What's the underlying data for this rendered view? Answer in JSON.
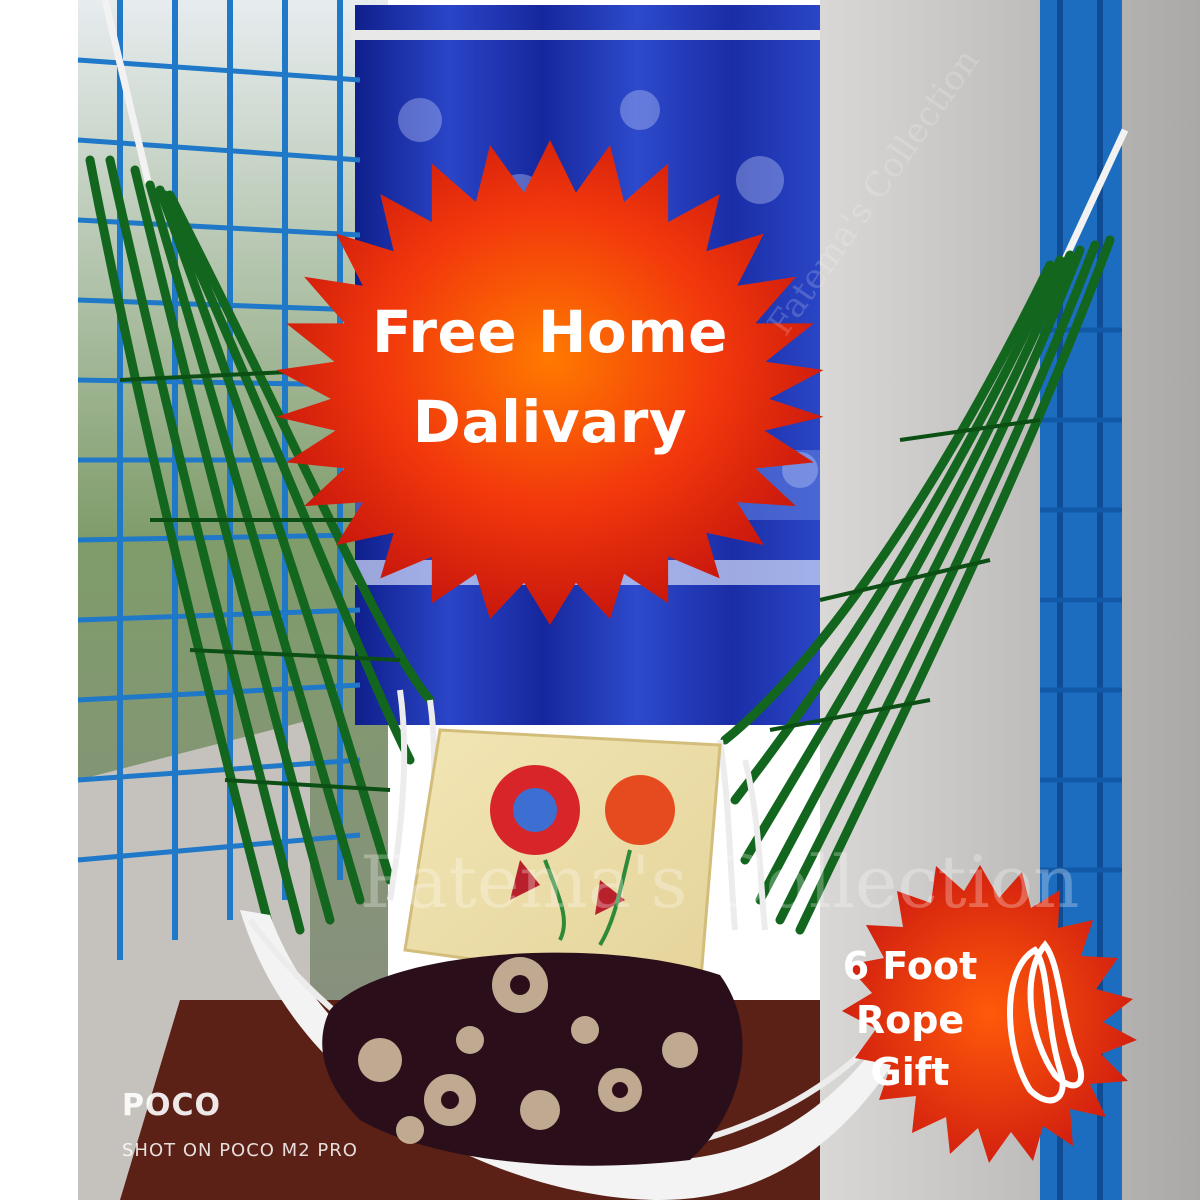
{
  "badges": {
    "main": {
      "line1": "Free Home",
      "line2": "Dalivary",
      "fill": "#e62a0e"
    },
    "gift": {
      "line1": "6 Foot",
      "line2": "Rope",
      "line3": "Gift",
      "fill": "#e22a10"
    }
  },
  "camera_mark": {
    "brand": "POCO",
    "shot": "SHOT ON POCO M2 PRO"
  },
  "watermark": {
    "text": "Fatema's Collection"
  },
  "colors": {
    "hammock_green": "#14631c",
    "curtain_blue": "#1b2fa8",
    "window_grill_blue": "#1d72c4",
    "wall": "#c9c7c4",
    "floor": "#6e2a1e"
  }
}
